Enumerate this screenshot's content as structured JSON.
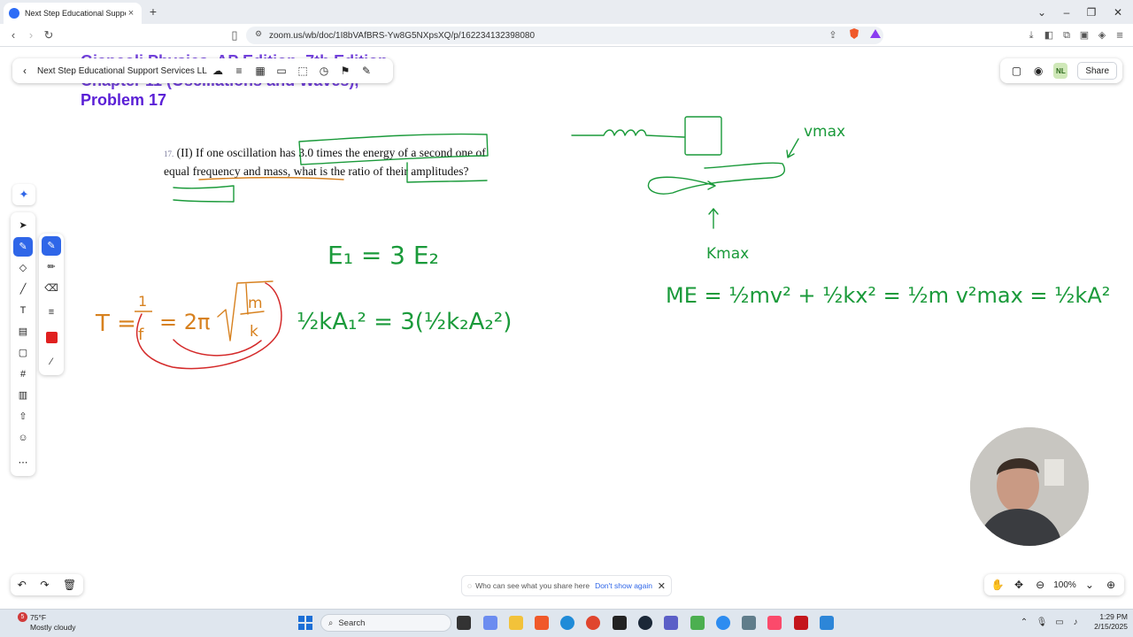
{
  "browser": {
    "tab_title": "Next Step Educational Support",
    "tab_close": "×",
    "new_tab": "+",
    "url": "zoom.us/wb/doc/1I8bVAfBRS-Yw8G5NXpsXQ/p/162234132398080",
    "window_controls": {
      "collapse": "⌄",
      "minimize": "–",
      "maximize": "❐",
      "close": "✕"
    }
  },
  "whiteboard": {
    "doc_title": "Next Step Educational Support Services LL...",
    "heading_lines": [
      "Giancoli Physics, AP Edition, 7th Edition",
      "Chapter 11 (Oscillations and Waves),",
      "Problem 17"
    ],
    "avatar_initials": "NL",
    "share_label": "Share",
    "problem": {
      "number": "17.",
      "text": "(II) If one oscillation has 3.0 times the energy of a second one of equal frequency and mass, what is the ratio of their amplitudes?"
    },
    "annotations": {
      "period_eq": "T = 1/f = 2π√(m/k)",
      "energy_eq": "E₁ = 3 E₂",
      "amplitude_eq": "½kA₁² = 3(½k₂A₂²)",
      "mech_energy_eq": "ME = ½mv² + ½kx² = ½m v²max = ½kA²",
      "v_max_label": "vmax",
      "k_max_label": "Kmax"
    },
    "share_notice": {
      "text": "Who can see what you share here",
      "link": "Don't show again",
      "close": "✕"
    },
    "zoom_level": "100%"
  },
  "colors": {
    "heading": "#5a1fd6",
    "ink_green": "#1a9a3a",
    "ink_orange": "#d7811f",
    "ink_red": "#d42a2a",
    "accent": "#2f66e8"
  },
  "taskbar": {
    "weather_temp": "75°F",
    "weather_desc": "Mostly cloudy",
    "weather_badge": "5",
    "search_placeholder": "Search",
    "time": "1:29 PM",
    "date": "2/15/2025"
  }
}
